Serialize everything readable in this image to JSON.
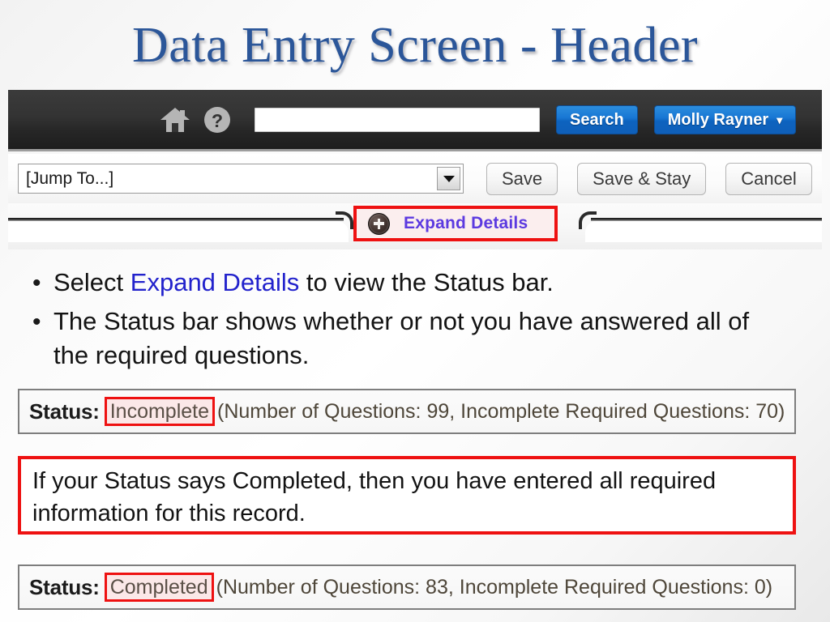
{
  "slide": {
    "title": "Data Entry Screen - Header"
  },
  "app": {
    "toolbar": {
      "home_icon": "home-icon",
      "help_icon": "help-question-icon",
      "search_value": "",
      "search_placeholder": "",
      "search_button": "Search",
      "user_menu": "Molly Rayner",
      "user_menu_caret": "▾"
    },
    "actionbar": {
      "jump_to": "[Jump To...]",
      "save": "Save",
      "save_and_stay": "Save & Stay",
      "cancel": "Cancel"
    },
    "tab": {
      "expand_details": "Expand Details",
      "plus_icon": "plus-circle-icon"
    }
  },
  "bullets": [
    {
      "marker": "•",
      "pre": "Select ",
      "highlight": "Expand Details",
      "post": " to view the Status bar."
    },
    {
      "marker": "•",
      "pre": "The Status bar shows whether or not you have answered all of the required questions.",
      "highlight": "",
      "post": ""
    }
  ],
  "status_bars": [
    {
      "label": "Status:",
      "value": "Incomplete",
      "detail": "(Number of Questions: 99, Incomplete Required Questions: 70)"
    },
    {
      "label": "Status:",
      "value": "Completed",
      "detail": "(Number of Questions: 83, Incomplete Required Questions: 0)"
    }
  ],
  "callout": {
    "text": "If your Status says Completed, then you have entered all required information for this record."
  },
  "colors": {
    "title_blue": "#2B5699",
    "highlight_red": "#EE1111",
    "link_blue": "#2222CC",
    "expand_purple": "#5C3AE0",
    "button_blue": "#1877D4",
    "toolbar_dark": "#333333"
  }
}
